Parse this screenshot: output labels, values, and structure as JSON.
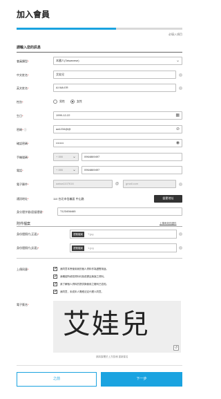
{
  "page": {
    "title": "加入會員",
    "required_note": "必填入項目",
    "progress_percent": 60
  },
  "section": {
    "title": "請輸入您的訊息"
  },
  "fields": {
    "member_type": {
      "label": "會員類型",
      "value": "本國人(Taiwanese)"
    },
    "chinese_name": {
      "label": "中文姓名",
      "value": "艾娃兒"
    },
    "english_name": {
      "label": "英文姓名",
      "value": "AI WA ER"
    },
    "gender": {
      "label": "性別",
      "options": [
        "男性",
        "女性"
      ],
      "selected": "女性"
    },
    "birthday": {
      "label": "生日",
      "value": "1999-12-22"
    },
    "password": {
      "label": "密碼",
      "value": "aa1234@@"
    },
    "confirm_password": {
      "label": "確認密碼",
      "value": "••••••••"
    },
    "mobile": {
      "label": "手機號碼",
      "country": "+ 886",
      "value": "0964869497"
    },
    "phone": {
      "label": "電話",
      "country": "+ 886",
      "value": "0964869497"
    },
    "email": {
      "label": "電子郵件",
      "value": "aaiwa1107616",
      "domain": "gmail.com"
    },
    "mail_address": {
      "label": "通訊地址",
      "value": "110 台北市信義區 中山路",
      "button": "變更地址"
    },
    "id_number": {
      "label": "身分證字號/居留證號",
      "value": "T123456465"
    }
  },
  "attachments": {
    "title": "附件檔案",
    "link": "上傳有效的證件",
    "front": {
      "label": "身份證照片(正面)",
      "button": "瀏覽檔案",
      "file": "T.jpg"
    },
    "back": {
      "label": "身份證照片(反面)",
      "button": "瀏覽檔案",
      "file": "1.jpg"
    }
  },
  "consent": {
    "label": "上傳同意",
    "items": [
      "我同意本會使用我的個人資料作為證實用途。",
      "我確認所填寫資料均為真實且無誤之資料。",
      "我了解個人資料的提供與使用之權利已告知。",
      "我同意，未成年人需經法定代理人同意。"
    ]
  },
  "signature": {
    "label": "電子簽名",
    "strokes_text": "艾娃兒",
    "hint": "請將簽署於上方區塊 重新簽名"
  },
  "buttons": {
    "prev": "之前",
    "next": "下一步"
  },
  "colors": {
    "accent": "#1aa3e0",
    "dark_button": "#333333",
    "required": "#e03030"
  }
}
